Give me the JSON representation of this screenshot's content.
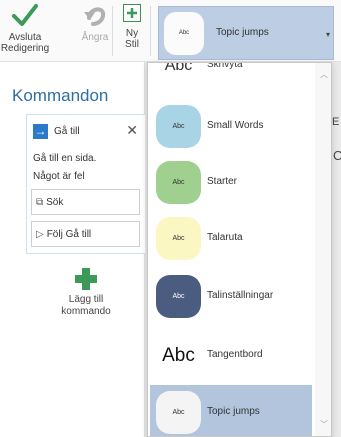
{
  "ribbon": {
    "done": {
      "line1": "Avsluta",
      "line2": "Redigering"
    },
    "undo": {
      "label": "Ångra"
    },
    "new_style": {
      "line1": "Ny",
      "line2": "Stil"
    }
  },
  "style_select": {
    "chip_text": "Abc",
    "value": "Topic jumps",
    "caret": "▾"
  },
  "panel": {
    "title": "Kommandon",
    "command": {
      "title": "Gå till",
      "close": "✕",
      "line1": "Gå till en sida.",
      "line2": "Något är fel",
      "field1": "Sök",
      "field2": "Följ Gå till"
    },
    "add": {
      "line1": "Lägg till",
      "line2": "kommando"
    }
  },
  "background_edge": {
    "char1": "E",
    "char2": "C"
  },
  "dropdown": {
    "options": [
      {
        "sample": "Abc",
        "label": "Skrivyta",
        "bg": "#ffffff"
      },
      {
        "sample": "Abc",
        "label": "Small Words",
        "bg": "#a9d4e6"
      },
      {
        "sample": "Abc",
        "label": "Starter",
        "bg": "#9fd08f"
      },
      {
        "sample": "Abc",
        "label": "Talaruta",
        "bg": "#fbf7c2"
      },
      {
        "sample": "Abc",
        "label": "Talinställningar",
        "bg": "#4a5d80"
      },
      {
        "sample": "Abc",
        "label": "Tangentbord",
        "bg": "#ffffff"
      },
      {
        "sample": "Abc",
        "label": "Topic jumps",
        "bg": "#f4f4f4"
      }
    ],
    "selected": "Topic jumps"
  },
  "colors": {
    "accent_blue": "#2a7acb",
    "title_blue": "#2f6ea3",
    "green": "#3b9a5a",
    "selection": "#b3c5dc"
  }
}
